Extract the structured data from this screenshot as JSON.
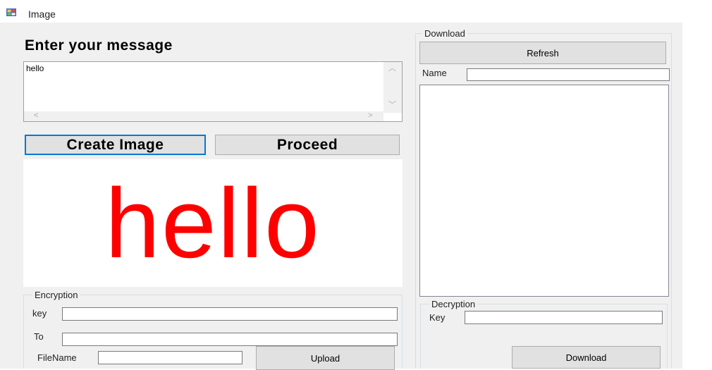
{
  "window": {
    "title": "Image",
    "icon": "app-window-icon"
  },
  "message": {
    "heading": "Enter your message",
    "text": "hello",
    "scroll_up": "︿",
    "scroll_down": "﹀",
    "scroll_left": "<",
    "scroll_right": ">"
  },
  "buttons": {
    "create_image": "Create Image",
    "proceed": "Proceed"
  },
  "preview": {
    "text": "hello",
    "color": "#ff0000"
  },
  "encryption": {
    "legend": "Encryption",
    "key_label": "key",
    "key_value": "",
    "to_label": "To",
    "to_value": "",
    "filename_label": "FileName",
    "filename_value": "",
    "upload_label": "Upload"
  },
  "download": {
    "legend": "Download",
    "refresh_label": "Refresh",
    "name_label": "Name",
    "name_value": "",
    "files": []
  },
  "decryption": {
    "legend": "Decryption",
    "key_label": "Key",
    "key_value": "",
    "download_label": "Download"
  },
  "colors": {
    "accent": "#0078d7",
    "preview_text": "#ff0000",
    "form_bg": "#f0f0f0"
  }
}
